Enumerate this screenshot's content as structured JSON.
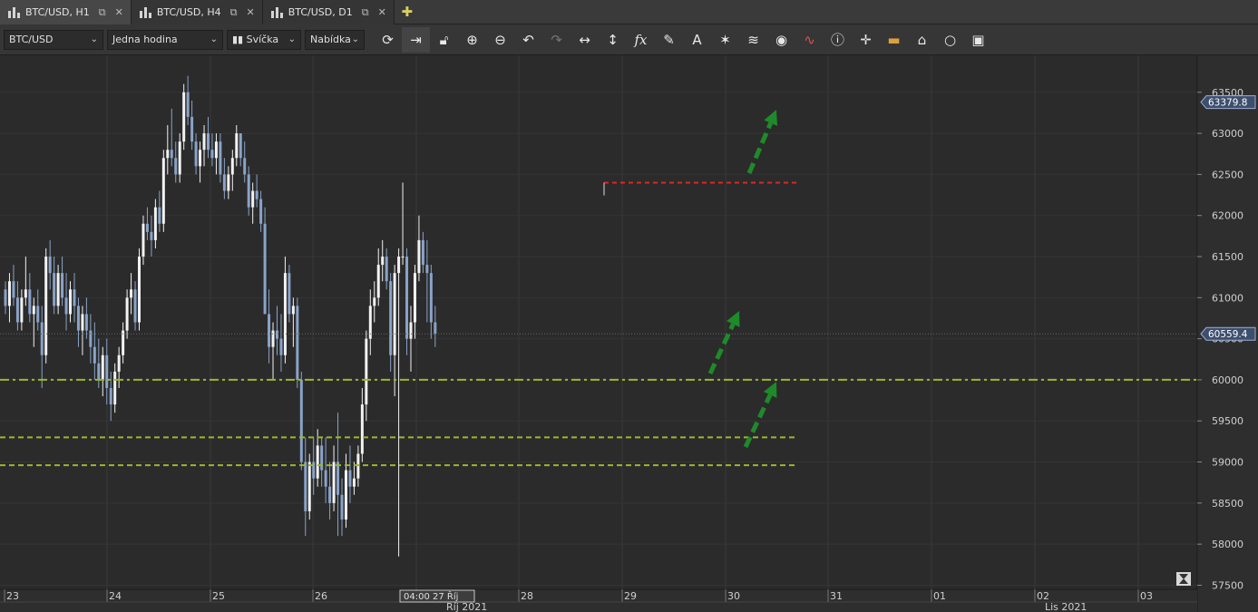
{
  "tabs": [
    {
      "label": "BTC/USD, H1",
      "active": true
    },
    {
      "label": "BTC/USD, H4",
      "active": false
    },
    {
      "label": "BTC/USD, D1",
      "active": false
    }
  ],
  "toolbar": {
    "symbol": "BTC/USD",
    "timeframe": "Jedna hodina",
    "chart_type": "Svíčka",
    "price_type": "Nabídka",
    "icons": [
      "refresh-icon",
      "auto-scroll-icon",
      "lock-icon",
      "zoom-in-icon",
      "zoom-out-icon",
      "magnet-icon",
      "undo-icon",
      "horizontal-measure-icon",
      "vertical-measure-icon",
      "fx-icon",
      "pencil-icon",
      "text-icon",
      "crosshair-icon",
      "layers-icon",
      "eye-icon",
      "indicators-icon",
      "info-icon",
      "cross-cursor-icon",
      "ruler-icon",
      "fill-icon",
      "circle-icon",
      "save-icon"
    ]
  },
  "chart_data": {
    "type": "candlestick",
    "y_axis_ticks": [
      57500,
      58000,
      58500,
      59000,
      59500,
      60000,
      60500,
      61000,
      61500,
      62000,
      62500,
      63000,
      63500
    ],
    "ylim": [
      57450,
      63950
    ],
    "price_labels": {
      "ask": "63379.8",
      "bid": "60559.4"
    },
    "price_label_values": {
      "ask": 63379.8,
      "bid": 60559.4
    },
    "x_axis_ticks": [
      "23",
      "24",
      "25",
      "26",
      "27",
      "28",
      "29",
      "30",
      "31",
      "01",
      "02",
      "03"
    ],
    "cursor_label": "04:00 27 Říj",
    "month_labels": [
      "Říj 2021",
      "Lis 2021"
    ],
    "horizontal_lines": [
      {
        "price": 60000,
        "color": "#9ab82e",
        "style": "dash-dot"
      },
      {
        "price": 59300,
        "color": "#9ab82e",
        "style": "dashed"
      },
      {
        "price": 58960,
        "color": "#9ab82e",
        "style": "dashed"
      },
      {
        "price": 62400,
        "color": "#e02424",
        "style": "dotted"
      }
    ],
    "candles": [
      [
        61100,
        61200,
        60800,
        60900
      ],
      [
        60900,
        61300,
        60700,
        61200
      ],
      [
        61200,
        61400,
        60900,
        61000
      ],
      [
        61000,
        61200,
        60600,
        60700
      ],
      [
        60700,
        61100,
        60600,
        61000
      ],
      [
        61000,
        61500,
        60900,
        61100
      ],
      [
        61100,
        61300,
        60700,
        60800
      ],
      [
        60800,
        61000,
        60400,
        60900
      ],
      [
        60900,
        61100,
        60600,
        60700
      ],
      [
        60700,
        60900,
        59900,
        60300
      ],
      [
        60300,
        61600,
        60200,
        61500
      ],
      [
        61500,
        61700,
        61100,
        61300
      ],
      [
        61300,
        61500,
        60800,
        60900
      ],
      [
        60900,
        61400,
        60800,
        61300
      ],
      [
        61300,
        61500,
        60900,
        61000
      ],
      [
        61000,
        61300,
        60600,
        60800
      ],
      [
        60800,
        61200,
        60700,
        61100
      ],
      [
        61100,
        61300,
        60700,
        60900
      ],
      [
        60900,
        61000,
        60400,
        60600
      ],
      [
        60600,
        60900,
        60300,
        60800
      ],
      [
        60800,
        61000,
        60500,
        60600
      ],
      [
        60600,
        60800,
        60200,
        60400
      ],
      [
        60400,
        60700,
        60000,
        60200
      ],
      [
        60200,
        60500,
        59900,
        60000
      ],
      [
        60000,
        60400,
        59800,
        60300
      ],
      [
        60300,
        60500,
        59700,
        59900
      ],
      [
        59900,
        60100,
        59500,
        59700
      ],
      [
        59700,
        60200,
        59600,
        60100
      ],
      [
        60100,
        60400,
        59900,
        60300
      ],
      [
        60300,
        60700,
        60200,
        60600
      ],
      [
        60600,
        61100,
        60500,
        61000
      ],
      [
        61000,
        61300,
        60800,
        61100
      ],
      [
        61100,
        61200,
        60600,
        60700
      ],
      [
        60700,
        61600,
        60600,
        61500
      ],
      [
        61500,
        62000,
        61400,
        61900
      ],
      [
        61900,
        62100,
        61700,
        61800
      ],
      [
        61800,
        62000,
        61500,
        61700
      ],
      [
        61700,
        62200,
        61600,
        62100
      ],
      [
        62100,
        62300,
        61800,
        61900
      ],
      [
        61900,
        62800,
        61800,
        62700
      ],
      [
        62700,
        63100,
        62500,
        62800
      ],
      [
        62800,
        63300,
        62600,
        62700
      ],
      [
        62700,
        62900,
        62400,
        62500
      ],
      [
        62500,
        63000,
        62400,
        62900
      ],
      [
        62900,
        63600,
        62800,
        63500
      ],
      [
        63500,
        63700,
        63100,
        63200
      ],
      [
        63200,
        63400,
        62800,
        62900
      ],
      [
        62900,
        63000,
        62500,
        62600
      ],
      [
        62600,
        62900,
        62400,
        62800
      ],
      [
        62800,
        63100,
        62600,
        63000
      ],
      [
        63000,
        63200,
        62700,
        62800
      ],
      [
        62800,
        63000,
        62600,
        62700
      ],
      [
        62700,
        63000,
        62500,
        62900
      ],
      [
        62900,
        63000,
        62400,
        62500
      ],
      [
        62500,
        62700,
        62200,
        62300
      ],
      [
        62300,
        62600,
        62200,
        62500
      ],
      [
        62500,
        62800,
        62300,
        62700
      ],
      [
        62700,
        63100,
        62600,
        63000
      ],
      [
        63000,
        63000,
        62600,
        62700
      ],
      [
        62700,
        62900,
        62400,
        62500
      ],
      [
        62500,
        62600,
        62000,
        62100
      ],
      [
        62100,
        62400,
        61900,
        62300
      ],
      [
        62300,
        62500,
        62100,
        62200
      ],
      [
        62200,
        62300,
        61800,
        61900
      ],
      [
        61900,
        62100,
        61500,
        60800
      ],
      [
        60800,
        61100,
        60200,
        60400
      ],
      [
        60400,
        60700,
        60000,
        60600
      ],
      [
        60600,
        60900,
        60300,
        60500
      ],
      [
        60500,
        60800,
        60100,
        60300
      ],
      [
        60300,
        61500,
        60200,
        61300
      ],
      [
        61300,
        61400,
        60700,
        60800
      ],
      [
        60800,
        61000,
        60400,
        60900
      ],
      [
        60900,
        61000,
        59900,
        60000
      ],
      [
        60000,
        60100,
        58900,
        59000
      ],
      [
        59000,
        59300,
        58100,
        58400
      ],
      [
        58400,
        59100,
        58300,
        59000
      ],
      [
        59000,
        59300,
        58600,
        58800
      ],
      [
        58800,
        59400,
        58700,
        59200
      ],
      [
        59200,
        59300,
        58700,
        58900
      ],
      [
        58900,
        59300,
        58500,
        58700
      ],
      [
        58700,
        59000,
        58300,
        58500
      ],
      [
        58500,
        59200,
        58400,
        59000
      ],
      [
        59000,
        59600,
        58100,
        58600
      ],
      [
        58600,
        58800,
        58100,
        58300
      ],
      [
        58300,
        59100,
        58200,
        58900
      ],
      [
        58900,
        59200,
        58500,
        58700
      ],
      [
        58700,
        59000,
        58600,
        58800
      ],
      [
        58800,
        59200,
        58700,
        59100
      ],
      [
        59100,
        59900,
        59000,
        59700
      ],
      [
        59700,
        60600,
        59500,
        60500
      ],
      [
        60500,
        61100,
        60300,
        60900
      ],
      [
        60900,
        61200,
        60700,
        61000
      ],
      [
        61000,
        61600,
        60900,
        61400
      ],
      [
        61400,
        61700,
        61200,
        61500
      ],
      [
        61500,
        61600,
        61100,
        61200
      ],
      [
        61200,
        61300,
        60100,
        60300
      ],
      [
        60300,
        61400,
        59800,
        61300
      ],
      [
        61300,
        61600,
        57850,
        61500
      ],
      [
        61500,
        62400,
        61400,
        61500
      ],
      [
        61500,
        61600,
        60300,
        60500
      ],
      [
        60500,
        60900,
        60100,
        60700
      ],
      [
        60700,
        61400,
        60500,
        61300
      ],
      [
        61300,
        62000,
        61200,
        61700
      ],
      [
        61700,
        61800,
        61300,
        61400
      ],
      [
        61400,
        61700,
        60700,
        61300
      ],
      [
        61300,
        61400,
        60500,
        60700
      ],
      [
        60700,
        60900,
        60400,
        60560
      ]
    ]
  }
}
